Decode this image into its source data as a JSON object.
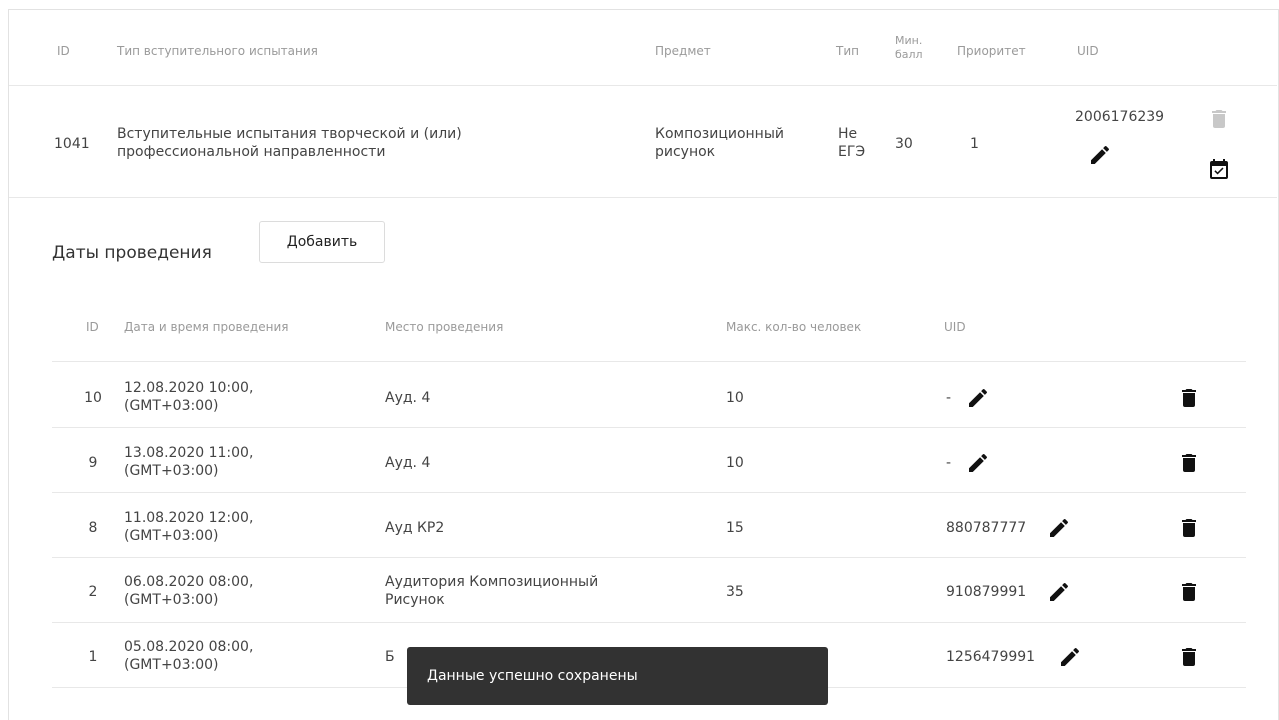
{
  "main_table": {
    "headers": {
      "id": "ID",
      "type": "Тип вступительного испытания",
      "subject": "Предмет",
      "kind": "Тип",
      "min_score_1": "Мин.",
      "min_score_2": "балл",
      "priority": "Приоритет",
      "uid": "UID"
    },
    "row": {
      "id": "1041",
      "type_line1": "Вступительные испытания творческой и (или)",
      "type_line2": "профессиональной направленности",
      "subject_line1": "Композиционный",
      "subject_line2": "рисунок",
      "kind_line1": "Не",
      "kind_line2": "ЕГЭ",
      "min_score": "30",
      "priority": "1",
      "uid": "2006176239"
    }
  },
  "dates_section": {
    "title": "Даты проведения",
    "add_button": "Добавить",
    "headers": {
      "id": "ID",
      "datetime": "Дата и время проведения",
      "place": "Место проведения",
      "max_people": "Макс. кол-во человек",
      "uid": "UID"
    },
    "rows": [
      {
        "id": "10",
        "date": "12.08.2020 10:00,",
        "tz": "(GMT+03:00)",
        "place1": "Ауд. 4",
        "place2": "",
        "max": "10",
        "uid": "-"
      },
      {
        "id": "9",
        "date": "13.08.2020 11:00,",
        "tz": "(GMT+03:00)",
        "place1": "Ауд. 4",
        "place2": "",
        "max": "10",
        "uid": "-"
      },
      {
        "id": "8",
        "date": "11.08.2020 12:00,",
        "tz": "(GMT+03:00)",
        "place1": "Ауд КР2",
        "place2": "",
        "max": "15",
        "uid": "880787777"
      },
      {
        "id": "2",
        "date": "06.08.2020 08:00,",
        "tz": "(GMT+03:00)",
        "place1": "Аудитория Композиционный",
        "place2": "Рисунок",
        "max": "35",
        "uid": "910879991"
      },
      {
        "id": "1",
        "date": "05.08.2020 08:00,",
        "tz": "(GMT+03:00)",
        "place1": "Б",
        "place2": "",
        "max": "",
        "uid": "1256479991"
      }
    ]
  },
  "toast": {
    "message": "Данные успешно сохранены"
  },
  "icons": {
    "edit": "pencil-icon",
    "delete": "trash-icon",
    "calendar": "calendar-check-icon"
  }
}
